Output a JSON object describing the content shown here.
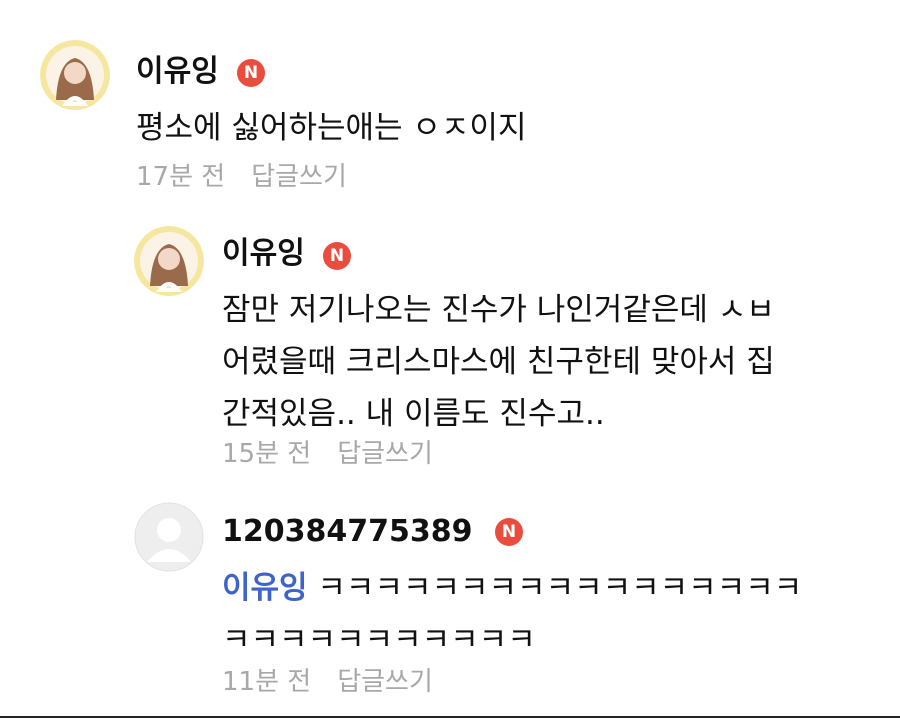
{
  "comments": [
    {
      "username": "이유잉",
      "badge": "N",
      "avatar_icon": "profile-photo-girl",
      "lines": [
        "평소에 싫어하는애는 ㅇㅈ이지"
      ],
      "time": "17분 전",
      "reply_label": "답글쓰기"
    },
    {
      "username": "이유잉",
      "badge": "N",
      "avatar_icon": "profile-photo-girl",
      "lines": [
        "잠만 저기나오는 진수가 나인거같은데 ㅅㅂ",
        "어렸을때 크리스마스에 친구한테 맞아서 집",
        "간적있음.. 내 이름도 진수고.."
      ],
      "time": "15분 전",
      "reply_label": "답글쓰기"
    },
    {
      "username": "120384775389",
      "badge": "N",
      "avatar_icon": "default-avatar",
      "mention": "이유잉",
      "lines": [
        " ㅋㅋㅋㅋㅋㅋㅋㅋㅋㅋㅋㅋㅋㅋㅋㅋㅋ",
        "ㅋㅋㅋㅋㅋㅋㅋㅋㅋㅋㅋ"
      ],
      "time": "11분 전",
      "reply_label": "답글쓰기"
    }
  ],
  "colors": {
    "badge": "#ea4c3d",
    "mention": "#3e64c9",
    "meta": "#a8a8a8"
  }
}
